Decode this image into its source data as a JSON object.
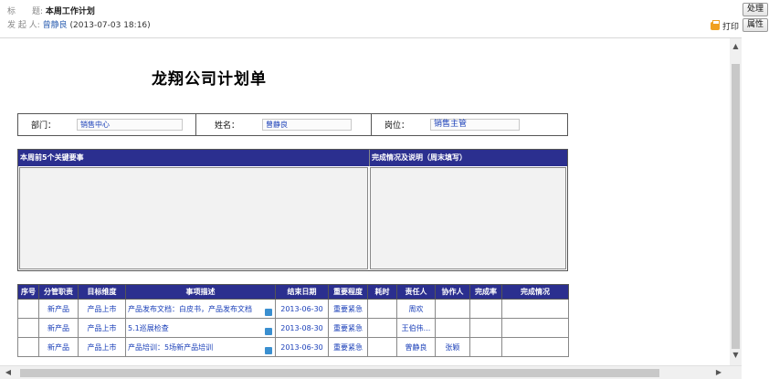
{
  "header": {
    "subject_label": "标　　题:",
    "subject": "本周工作计划",
    "sender_label": "发 起 人:",
    "sender": "曾静良",
    "sent_time": "(2013-07-03 18:16)",
    "print_label": "打印"
  },
  "side_buttons": {
    "process": "处理",
    "properties": "属性"
  },
  "form": {
    "title": "龙翔公司计划单",
    "dept_label": "部门：",
    "dept_value": "销售中心",
    "name_label": "姓名：",
    "name_value": "曾静良",
    "position_label": "岗位：",
    "position_value": "销售主管"
  },
  "key_table": {
    "col1": "本周前5个关键要事",
    "col2": "完成情况及说明（周末填写）"
  },
  "tasks": {
    "headers": [
      "序号",
      "分管职责",
      "目标维度",
      "事项描述",
      "结束日期",
      "重要程度",
      "耗时",
      "责任人",
      "协作人",
      "完成率",
      "完成情况"
    ],
    "rows": [
      {
        "duty": "新产品",
        "target": "产品上市",
        "desc": "产品发布文档：白皮书，产品发布文档",
        "end": "2013-06-30",
        "importance": "重要紧急",
        "owner": "周欢",
        "helper": ""
      },
      {
        "duty": "新产品",
        "target": "产品上市",
        "desc": "5.1巡展检查",
        "end": "2013-08-30",
        "importance": "重要紧急",
        "owner": "王伯伟...",
        "helper": ""
      },
      {
        "duty": "新产品",
        "target": "产品上市",
        "desc": "产品培训：5场新产品培训",
        "end": "2013-06-30",
        "importance": "重要紧急",
        "owner": "曾静良",
        "helper": "张颖"
      }
    ]
  },
  "icons": {
    "print": "printer-icon",
    "attachment": "attachment-icon"
  },
  "colors": {
    "table_header": "#2b2f8f",
    "value_text": "#1a3fb8"
  }
}
